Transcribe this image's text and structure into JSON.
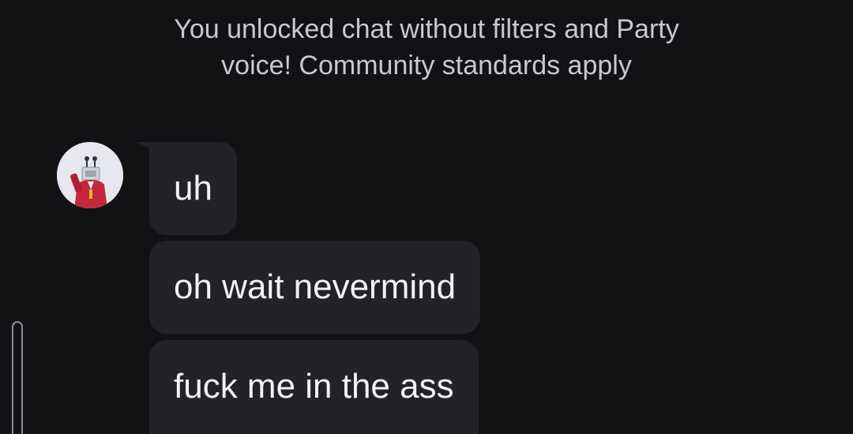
{
  "notice": {
    "line1": "You unlocked chat without filters and Party",
    "line2": "voice! Community standards apply"
  },
  "messages": [
    {
      "text": "uh"
    },
    {
      "text": "oh wait nevermind"
    },
    {
      "text": "fuck me in the ass"
    }
  ],
  "colors": {
    "background": "#121215",
    "bubble": "#222328",
    "bubble_text": "#f2f2f4",
    "notice_text": "#c8c9cd",
    "avatar_bg": "#e7e7ef",
    "avatar_outfit": "#c4283a"
  },
  "icons": {
    "avatar": "robot-avatar-icon",
    "scrollbar": "scroll-handle"
  }
}
